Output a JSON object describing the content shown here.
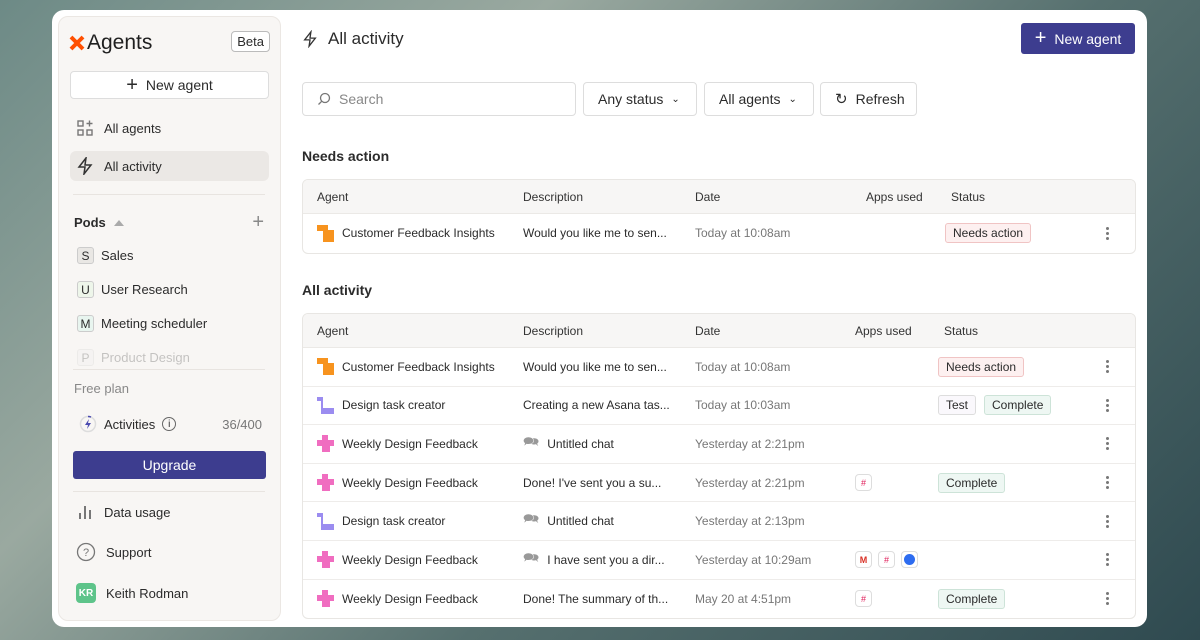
{
  "sidebar": {
    "brand": "Agents",
    "beta": "Beta",
    "new_agent": "New agent",
    "nav": [
      {
        "label": "All agents",
        "icon": "grid-plus-icon"
      },
      {
        "label": "All activity",
        "icon": "lightning-icon",
        "active": true
      }
    ],
    "pods_label": "Pods",
    "pods": [
      {
        "letter": "S",
        "label": "Sales",
        "color": "#e9e7e4"
      },
      {
        "letter": "U",
        "label": "User Research",
        "color": "#eef6ea"
      },
      {
        "letter": "M",
        "label": "Meeting scheduler",
        "color": "#e8f5ef"
      },
      {
        "letter": "P",
        "label": "Product Design",
        "color": "#eee"
      }
    ],
    "plan": "Free plan",
    "activities_label": "Activities",
    "activities_count": "36/400",
    "upgrade": "Upgrade",
    "data_usage": "Data usage",
    "support": "Support",
    "user_initials": "KR",
    "user_name": "Keith Rodman"
  },
  "header": {
    "title": "All activity",
    "new_agent": "New agent"
  },
  "filters": {
    "search_placeholder": "Search",
    "status": "Any status",
    "agents": "All agents",
    "refresh": "Refresh"
  },
  "columns": [
    "Agent",
    "Description",
    "Date",
    "Apps used",
    "Status"
  ],
  "needs_action": {
    "title": "Needs action",
    "rows": [
      {
        "agent": "Customer Feedback Insights",
        "icon": "orange",
        "description": "Would you like me to sen...",
        "date": "Today at 10:08am",
        "apps": [],
        "status": [
          {
            "label": "Needs action",
            "kind": "need"
          }
        ]
      }
    ]
  },
  "all_activity": {
    "title": "All activity",
    "rows": [
      {
        "agent": "Customer Feedback Insights",
        "icon": "orange",
        "description": "Would you like me to sen...",
        "date": "Today at 10:08am",
        "apps": [],
        "status": [
          {
            "label": "Needs action",
            "kind": "need"
          }
        ]
      },
      {
        "agent": "Design task creator",
        "icon": "purple",
        "description": "Creating a new Asana tas...",
        "date": "Today at 10:03am",
        "apps": [],
        "status": [
          {
            "label": "Test",
            "kind": "test"
          },
          {
            "label": "Complete",
            "kind": "comp"
          }
        ]
      },
      {
        "agent": "Weekly Design Feedback",
        "icon": "pink",
        "description": "Untitled chat",
        "chat": true,
        "date": "Yesterday at 2:21pm",
        "apps": [],
        "status": []
      },
      {
        "agent": "Weekly Design Feedback",
        "icon": "pink",
        "description": "Done! I've sent you a su...",
        "date": "Yesterday at 2:21pm",
        "apps": [
          "slack"
        ],
        "status": [
          {
            "label": "Complete",
            "kind": "comp"
          }
        ]
      },
      {
        "agent": "Design task creator",
        "icon": "purple",
        "description": "Untitled chat",
        "chat": true,
        "date": "Yesterday at 2:13pm",
        "apps": [],
        "status": []
      },
      {
        "agent": "Weekly Design Feedback",
        "icon": "pink",
        "description": "I have sent you a dir...",
        "chat": true,
        "date": "Yesterday at 10:29am",
        "apps": [
          "gmail",
          "slack",
          "zoom"
        ],
        "status": []
      },
      {
        "agent": "Weekly Design Feedback",
        "icon": "pink",
        "description": "Done! The summary of th...",
        "date": "May 20 at 4:51pm",
        "apps": [
          "slack"
        ],
        "status": [
          {
            "label": "Complete",
            "kind": "comp"
          }
        ]
      }
    ]
  },
  "colors": {
    "accent": "#3d3d8f",
    "orange": "#f7931e",
    "purple": "#9b8cf0",
    "pink": "#f06dc0",
    "brand": "#ff4f00"
  }
}
